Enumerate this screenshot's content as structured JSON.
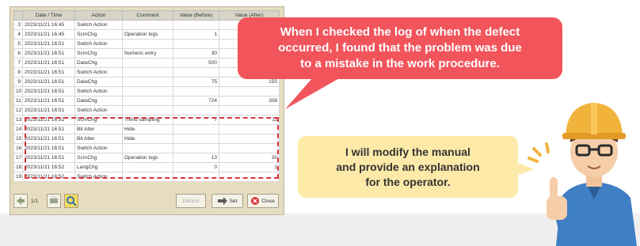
{
  "table": {
    "headers": [
      "Date / Time",
      "Action",
      "Comment",
      "Value (Before)",
      "Value (After)"
    ],
    "rows": [
      {
        "no": "3",
        "date": "2023/11/21 16:45",
        "action": "Switch Action",
        "comment": "",
        "before": "",
        "after": ""
      },
      {
        "no": "4",
        "date": "2023/11/21 16:45",
        "action": "ScrnChg",
        "comment": "Operation logs",
        "before": "1",
        "after": ""
      },
      {
        "no": "5",
        "date": "2023/11/21 16:51",
        "action": "Switch Action",
        "comment": "",
        "before": "",
        "after": ""
      },
      {
        "no": "6",
        "date": "2023/11/21 16:51",
        "action": "ScrnChg",
        "comment": "Numeric entry",
        "before": "30",
        "after": ""
      },
      {
        "no": "7",
        "date": "2023/11/21 16:51",
        "action": "DataChg",
        "comment": "",
        "before": "500",
        "after": ""
      },
      {
        "no": "8",
        "date": "2023/11/21 16:51",
        "action": "Switch Action",
        "comment": "",
        "before": "",
        "after": ""
      },
      {
        "no": "9",
        "date": "2023/11/21 16:51",
        "action": "DataChg",
        "comment": "",
        "before": "75",
        "after": "150"
      },
      {
        "no": "10",
        "date": "2023/11/21 16:51",
        "action": "Switch Action",
        "comment": "",
        "before": "",
        "after": ""
      },
      {
        "no": "11",
        "date": "2023/11/21 16:51",
        "action": "DataChg",
        "comment": "",
        "before": "724",
        "after": "308"
      },
      {
        "no": "12",
        "date": "2023/11/21 16:51",
        "action": "Switch Action",
        "comment": "",
        "before": "",
        "after": ""
      },
      {
        "no": "13",
        "date": "2023/11/21 16:51",
        "action": "ScrnChg",
        "comment": "Trend sampling",
        "before": "7",
        "after": "11"
      },
      {
        "no": "14",
        "date": "2023/11/21 16:51",
        "action": "Bit Alter",
        "comment": "Hide",
        "before": "",
        "after": ""
      },
      {
        "no": "15",
        "date": "2023/11/21 16:51",
        "action": "Bit Alter",
        "comment": "Hide",
        "before": "",
        "after": ""
      },
      {
        "no": "16",
        "date": "2023/11/21 16:51",
        "action": "Switch Action",
        "comment": "",
        "before": "",
        "after": ""
      },
      {
        "no": "17",
        "date": "2023/11/21 16:51",
        "action": "ScrnChg",
        "comment": "Operation logs",
        "before": "13",
        "after": "30"
      },
      {
        "no": "18",
        "date": "2023/11/21 16:52",
        "action": "LangChg",
        "comment": "",
        "before": "0",
        "after": "1"
      },
      {
        "no": "19",
        "date": "2023/11/21 16:52",
        "action": "Switch Action",
        "comment": "",
        "before": "",
        "after": ""
      }
    ]
  },
  "footer": {
    "page": "1/1",
    "default_label": "Default",
    "set_label": "Set",
    "close_label": "Close"
  },
  "bubble_red": {
    "line1": "When I checked the log of when the defect",
    "line2": "occurred, I found that the problem was due",
    "line3": "to a mistake in the work procedure."
  },
  "bubble_yellow": {
    "line1": "I will modify the manual",
    "line2": "and provide an explanation",
    "line3": "for the operator."
  },
  "colors": {
    "accent_red": "#f2545b",
    "bubble_yellow": "#fde9a8",
    "highlight": "#d9343a",
    "helmet": "#f2b33d"
  }
}
